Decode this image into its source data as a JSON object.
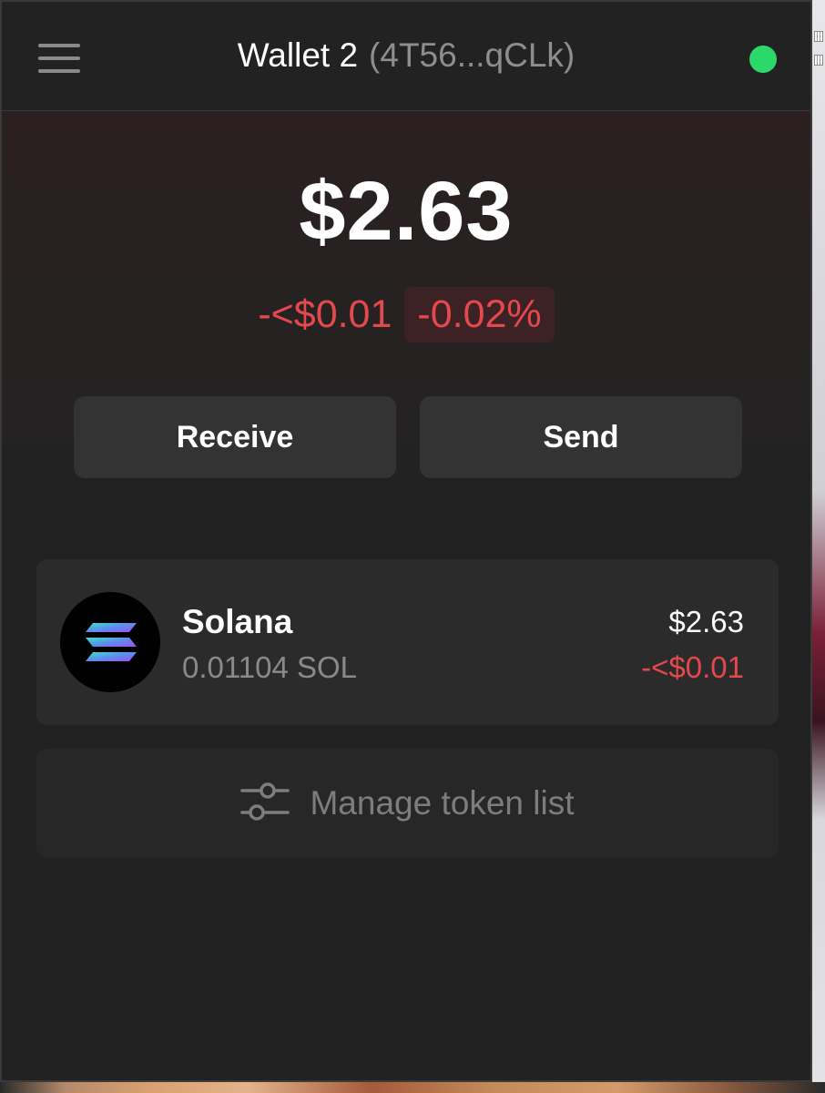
{
  "header": {
    "wallet_name": "Wallet 2",
    "wallet_address": "(4T56...qCLk)",
    "menu_icon": "hamburger-menu-icon",
    "status_color": "#2bd96b"
  },
  "balance": {
    "total": "$2.63",
    "change_abs": "-<$0.01",
    "change_pct": "-0.02%",
    "negative_color": "#e5484d"
  },
  "actions": {
    "receive_label": "Receive",
    "send_label": "Send"
  },
  "tokens": [
    {
      "name": "Solana",
      "amount": "0.01104 SOL",
      "value": "$2.63",
      "change": "-<$0.01",
      "icon": "solana-logo-icon"
    }
  ],
  "manage": {
    "label": "Manage token list",
    "icon": "sliders-icon"
  }
}
